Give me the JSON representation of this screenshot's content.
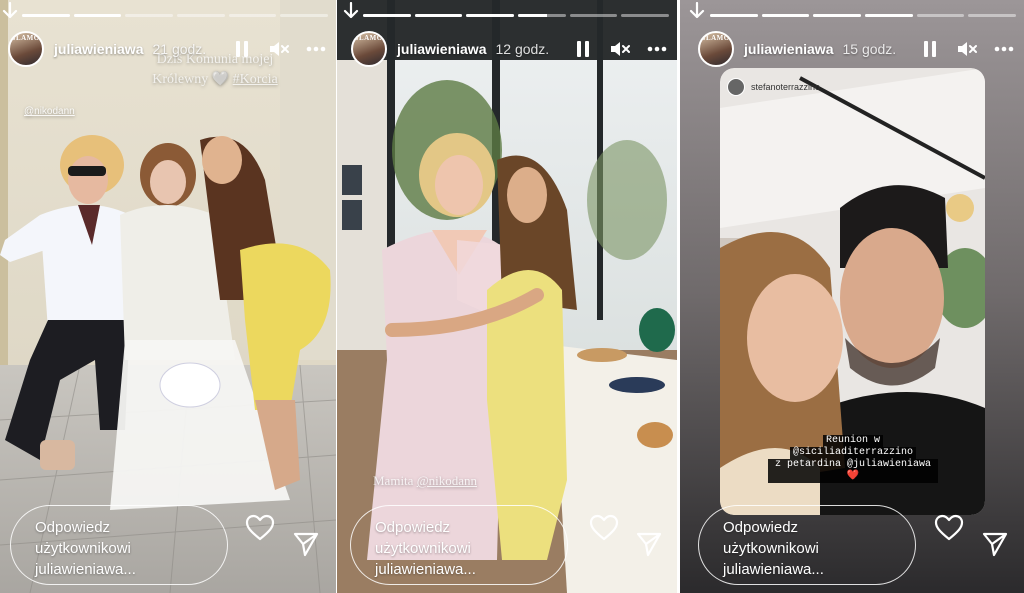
{
  "stories": [
    {
      "username": "juliawieniawa",
      "time": "21 godz.",
      "progress": [
        1,
        1,
        0,
        0,
        0,
        0
      ],
      "caption_line1": "Dziś Komunia mojej",
      "caption_line2": "Królewny 🤍 ",
      "caption_tag": "#Korcia",
      "mention": "@nikodann",
      "reply_line1": "Odpowiedz",
      "reply_line2": "użytkownikowi",
      "reply_line3": "juliawieniawa..."
    },
    {
      "username": "juliawieniawa",
      "time": "12 godz.",
      "progress": [
        1,
        1,
        1,
        0.6,
        0,
        0
      ],
      "caption_prefix": "Mamita ",
      "caption_mention": "@nikodann",
      "reply_line1": "Odpowiedz",
      "reply_line2": "użytkownikowi",
      "reply_line3": "juliawieniawa..."
    },
    {
      "username": "juliawieniawa",
      "time": "15 godz.",
      "progress": [
        1,
        1,
        1,
        1,
        0,
        0
      ],
      "repost_user": "stefanoterrazzino",
      "repost_line1": "Reunion w",
      "repost_line2": "@siciliaditerrazzino",
      "repost_line3": "z petardina @juliawieniawa❤️",
      "reply_line1": "Odpowiedz",
      "reply_line2": "użytkownikowi",
      "reply_line3": "juliawieniawa..."
    }
  ],
  "avatar_text": "GLAMOUR",
  "icons": {
    "back": "arrow-down-icon",
    "pause": "pause-icon",
    "mute": "speaker-muted-icon",
    "more": "more-horizontal-icon",
    "like": "heart-icon",
    "share": "send-icon"
  }
}
